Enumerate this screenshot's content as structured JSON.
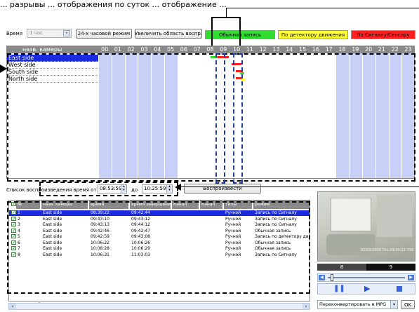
{
  "toolbar": {
    "time_label": "Время",
    "hour_select": "1 час",
    "mode_button": "24-х часовой режим",
    "zoom_button": "Увеличить область воспр.",
    "legend": [
      {
        "label": "Обычная запись",
        "color": "#2fdc2f"
      },
      {
        "label": "По детектору движения",
        "color": "#ffff33"
      },
      {
        "label": "По Сигналу/Сенсору",
        "color": "#ff2020"
      }
    ]
  },
  "timeline": {
    "header_label": "назв. камеры",
    "hours": [
      "00",
      "01",
      "02",
      "03",
      "04",
      "05",
      "06",
      "07",
      "08",
      "09",
      "10",
      "11",
      "12",
      "13",
      "14",
      "15",
      "16",
      "17",
      "18",
      "19",
      "20",
      "21",
      "22",
      "23"
    ],
    "cameras": [
      "East side",
      "West side",
      "South side",
      "North side"
    ],
    "selected_camera_index": 0,
    "colors": {
      "shaded": "#c8d0f8",
      "white": "#ffffff",
      "selected": "#1a2ae0"
    }
  },
  "playlist_bar": {
    "label": "Список воспроизведения  время  от",
    "from_value": "08:53:59",
    "to_label": "до",
    "to_value": "10:25:59",
    "play_button": "Воспроизвести"
  },
  "table": {
    "columns": [
      "№",
      "назв. камеры",
      "время",
      "время завершения",
      "Канал",
      "Канал",
      "типы",
      "режим"
    ],
    "rows": [
      {
        "n": "1",
        "cam": "East side",
        "start": "08:39:22",
        "end": "09:42:44",
        "type": "Ручной",
        "mode": "Запись по Сигналу"
      },
      {
        "n": "2",
        "cam": "East side",
        "start": "09:43:10",
        "end": "09:43:12",
        "type": "Ручной",
        "mode": "Запись по Сигналу"
      },
      {
        "n": "3",
        "cam": "East side",
        "start": "09:43:13",
        "end": "09:44:12",
        "type": "Ручной",
        "mode": "Запись по Сигналу"
      },
      {
        "n": "4",
        "cam": "East side",
        "start": "09:42:46",
        "end": "09:42:47",
        "type": "Ручной",
        "mode": "Обычная запись"
      },
      {
        "n": "5",
        "cam": "East side",
        "start": "09:42:59",
        "end": "09:43:08",
        "type": "Ручной",
        "mode": "Запись по детектору дв."
      },
      {
        "n": "6",
        "cam": "East side",
        "start": "10:06:22",
        "end": "10:06:26",
        "type": "Ручной",
        "mode": "Обычная запись"
      },
      {
        "n": "7",
        "cam": "East side",
        "start": "10:08:28",
        "end": "10:06:29",
        "type": "Ручной",
        "mode": "Обычная запись"
      },
      {
        "n": "8",
        "cam": "East side",
        "start": "10:06:31",
        "end": "11:03:03",
        "type": "Ручной",
        "mode": "Запись по Сигналу"
      }
    ]
  },
  "player": {
    "timestamp": "02/03/2009 Thu 09:39:22:738",
    "channel_left": "8",
    "channel_right": "9",
    "convert_select": "Переконвертировать в MPG",
    "ok_button": "OK"
  },
  "top_caption": "... разрывы ... отображения по суток ... отображение ..."
}
